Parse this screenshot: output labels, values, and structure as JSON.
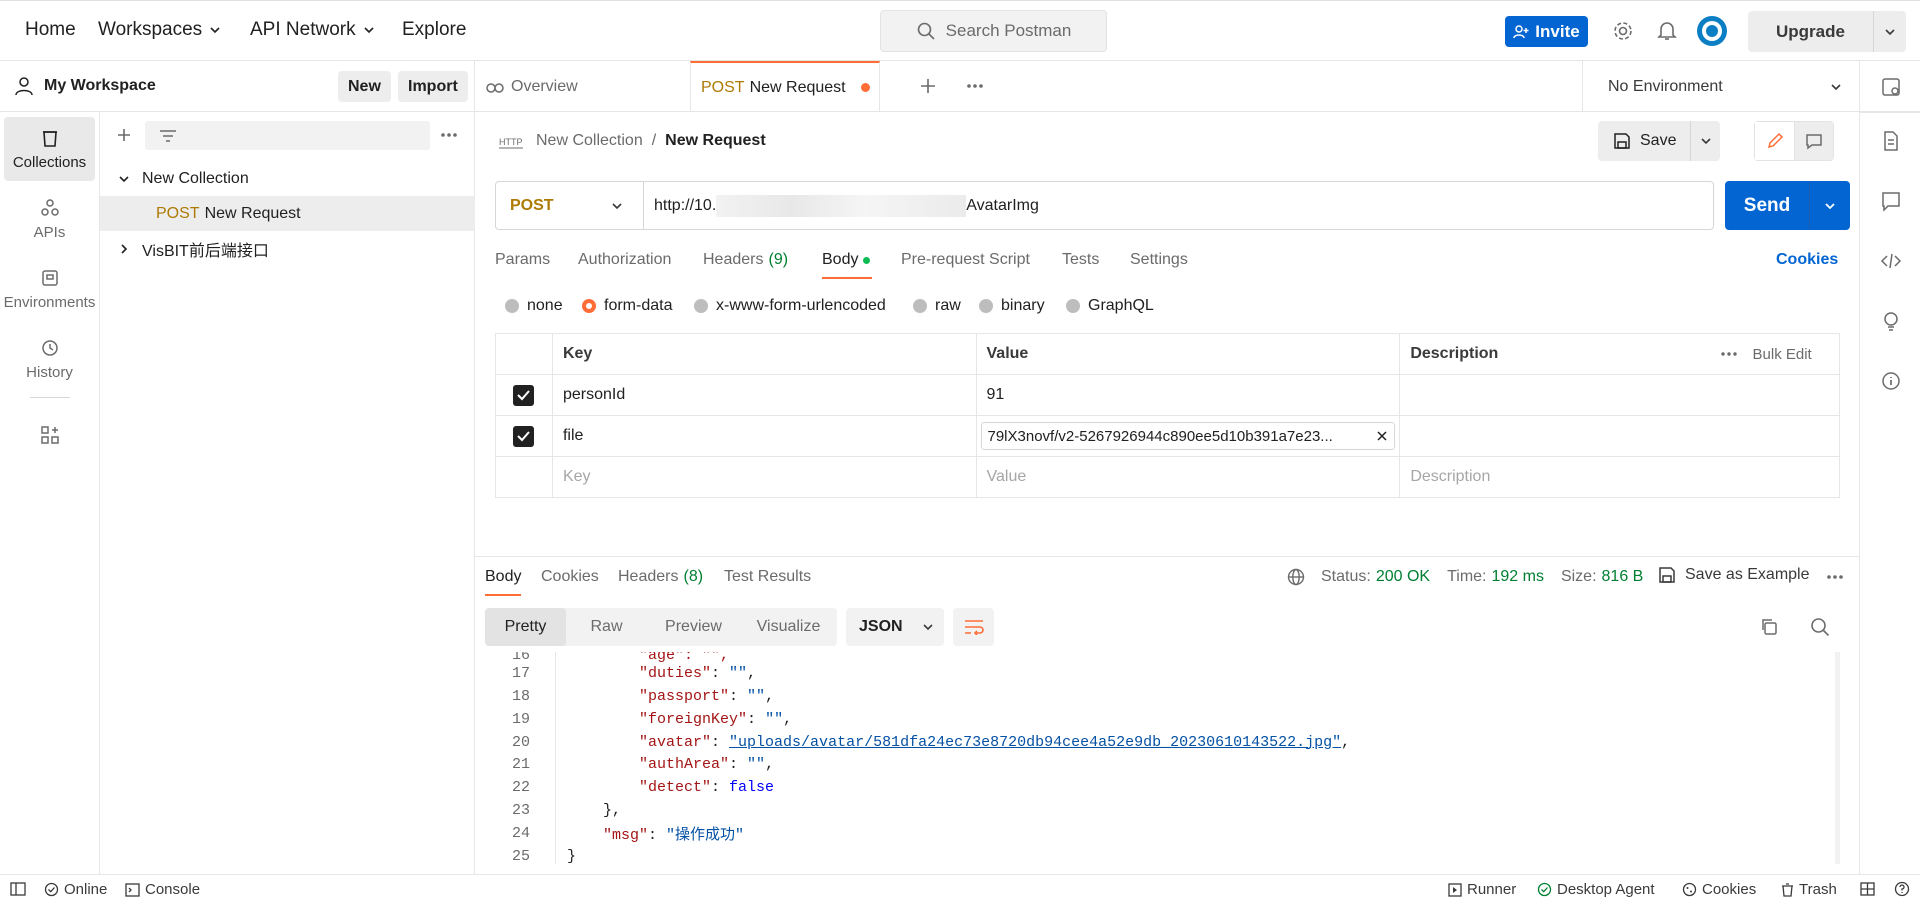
{
  "topnav": {
    "home": "Home",
    "workspaces": "Workspaces",
    "api_network": "API Network",
    "explore": "Explore",
    "search_placeholder": "Search Postman",
    "invite": "Invite",
    "upgrade": "Upgrade"
  },
  "workspace": {
    "name": "My Workspace",
    "new_label": "New",
    "import_label": "Import"
  },
  "iconbar": {
    "collections": "Collections",
    "apis": "APIs",
    "environments": "Environments",
    "history": "History"
  },
  "sidebar": {
    "collection_1": "New Collection",
    "request_method": "POST",
    "request_name": "New Request",
    "collection_2": "VisBIT前后端接口"
  },
  "tabs": {
    "overview": "Overview",
    "active_method": "POST",
    "active_name": "New Request",
    "environment": "No Environment"
  },
  "request": {
    "breadcrumb_collection": "New Collection",
    "breadcrumb_sep": "/",
    "breadcrumb_request": "New Request",
    "save_label": "Save",
    "method": "POST",
    "url_start": "http://10.",
    "url_end": "AvatarImg",
    "send_label": "Send",
    "tabs": {
      "params": "Params",
      "authorization": "Authorization",
      "headers": "Headers",
      "headers_count": "(9)",
      "body": "Body",
      "pre_request": "Pre-request Script",
      "tests": "Tests",
      "settings": "Settings",
      "cookies": "Cookies"
    },
    "body_types": [
      "none",
      "form-data",
      "x-www-form-urlencoded",
      "raw",
      "binary",
      "GraphQL"
    ],
    "table": {
      "col_key": "Key",
      "col_value": "Value",
      "col_description": "Description",
      "bulk_edit": "Bulk Edit",
      "rows": [
        {
          "key": "personId",
          "value": "91"
        },
        {
          "key": "file",
          "value": "79lX3novf/v2-5267926944c890ee5d10b391a7e23..."
        }
      ],
      "placeholder_key": "Key",
      "placeholder_value": "Value",
      "placeholder_description": "Description"
    }
  },
  "response": {
    "tabs": {
      "body": "Body",
      "cookies": "Cookies",
      "headers": "Headers",
      "headers_count": "(8)",
      "test_results": "Test Results"
    },
    "status_label": "Status:",
    "status_value": "200 OK",
    "time_label": "Time:",
    "time_value": "192 ms",
    "size_label": "Size:",
    "size_value": "816 B",
    "save_example": "Save as Example",
    "views": [
      "Pretty",
      "Raw",
      "Preview",
      "Visualize"
    ],
    "format": "JSON",
    "code_lines": [
      {
        "n": "16",
        "text": "        \"age\": \"\","
      },
      {
        "n": "17",
        "key": "\"duties\"",
        "val": "\"\"",
        "indent": "        "
      },
      {
        "n": "18",
        "key": "\"passport\"",
        "val": "\"\"",
        "indent": "        "
      },
      {
        "n": "19",
        "key": "\"foreignKey\"",
        "val": "\"\"",
        "indent": "        "
      },
      {
        "n": "20",
        "key": "\"avatar\"",
        "val": "\"uploads/avatar/581dfa24ec73e8720db94cee4a52e9db_20230610143522.jpg\"",
        "indent": "        "
      },
      {
        "n": "21",
        "key": "\"authArea\"",
        "val": "\"\"",
        "indent": "        "
      },
      {
        "n": "22",
        "key": "\"detect\"",
        "val": "false",
        "indent": "        ",
        "last": true
      },
      {
        "n": "23",
        "text": "    },"
      },
      {
        "n": "24",
        "key": "\"msg\"",
        "val": "\"操作成功\"",
        "indent": "    ",
        "last": true
      },
      {
        "n": "25",
        "text": "}"
      }
    ]
  },
  "statusbar": {
    "online": "Online",
    "console": "Console",
    "runner": "Runner",
    "desktop_agent": "Desktop Agent",
    "cookies": "Cookies",
    "trash": "Trash"
  },
  "colors": {
    "accent_orange": "#ff6c37",
    "primary_blue": "#0265d2",
    "post_method": "#ad7a03",
    "status_green": "#007f31"
  }
}
